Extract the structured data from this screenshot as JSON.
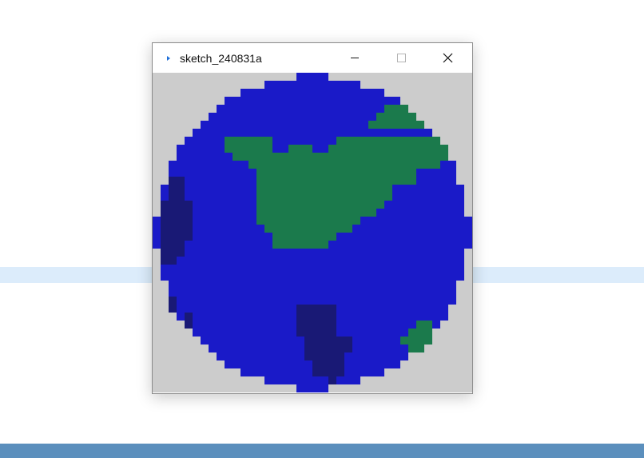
{
  "window": {
    "title": "sketch_240831a",
    "icon": "processing-arrow-icon"
  },
  "controls": {
    "minimize_icon": "minimize-icon",
    "maximize_icon": "maximize-icon",
    "close_icon": "close-icon"
  },
  "sketch": {
    "description_icon": "pixel-planet",
    "colors": {
      "background": "#cccccc",
      "ocean": "#1a1ac8",
      "deep_ocean": "#191975",
      "land": "#1b7a4c"
    }
  }
}
